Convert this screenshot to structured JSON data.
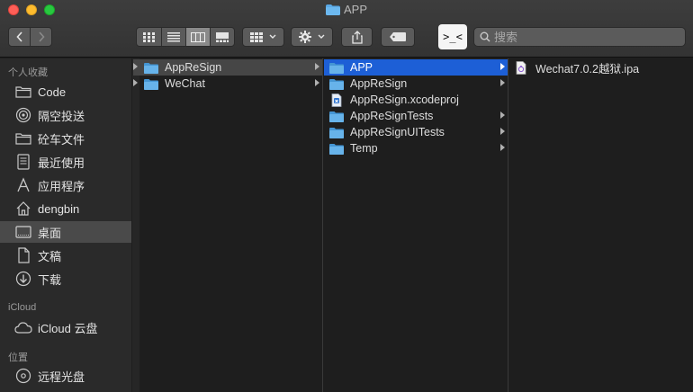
{
  "window": {
    "title": "APP"
  },
  "toolbar": {
    "back_label": "‹",
    "forward_label": "›",
    "terminal_label": ">_<",
    "search_placeholder": "搜索"
  },
  "sidebar": {
    "favorites_heading": "个人收藏",
    "favorites": [
      {
        "label": "Code",
        "icon": "folder-icon"
      },
      {
        "label": "隔空投送",
        "icon": "airdrop-icon"
      },
      {
        "label": "砼车文件",
        "icon": "folder-icon"
      },
      {
        "label": "最近使用",
        "icon": "recents-icon"
      },
      {
        "label": "应用程序",
        "icon": "applications-icon"
      },
      {
        "label": "dengbin",
        "icon": "home-icon"
      },
      {
        "label": "桌面",
        "icon": "desktop-icon",
        "selected": true
      },
      {
        "label": "文稿",
        "icon": "documents-icon"
      },
      {
        "label": "下载",
        "icon": "downloads-icon"
      }
    ],
    "icloud_heading": "iCloud",
    "icloud": [
      {
        "label": "iCloud 云盘",
        "icon": "cloud-icon"
      }
    ],
    "locations_heading": "位置",
    "locations": [
      {
        "label": "远程光盘",
        "icon": "disc-icon"
      }
    ]
  },
  "columns": [
    {
      "items": [
        {
          "name": "AppReSign",
          "kind": "folder",
          "has_children": true,
          "state": "selected-inactive"
        },
        {
          "name": "WeChat",
          "kind": "folder",
          "has_children": true
        }
      ]
    },
    {
      "items": [
        {
          "name": "APP",
          "kind": "folder",
          "has_children": true,
          "state": "selected-active"
        },
        {
          "name": "AppReSign",
          "kind": "folder",
          "has_children": true
        },
        {
          "name": "AppReSign.xcodeproj",
          "kind": "file",
          "has_children": false
        },
        {
          "name": "AppReSignTests",
          "kind": "folder",
          "has_children": true
        },
        {
          "name": "AppReSignUITests",
          "kind": "folder",
          "has_children": true
        },
        {
          "name": "Temp",
          "kind": "folder",
          "has_children": true
        }
      ]
    },
    {
      "items": [
        {
          "name": "Wechat7.0.2越狱.ipa",
          "kind": "ipa",
          "has_children": false
        }
      ]
    }
  ],
  "colors": {
    "accent": "#1d5fd6",
    "folder": "#5aa9e6"
  }
}
